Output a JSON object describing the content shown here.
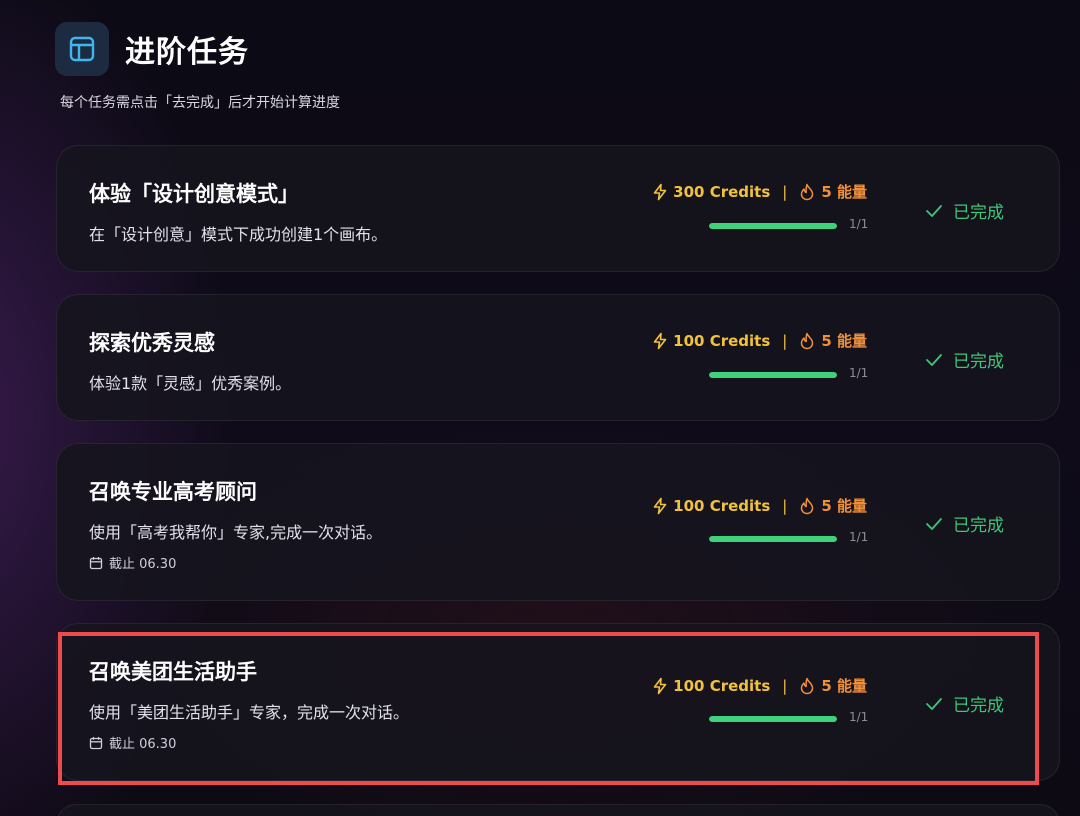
{
  "header": {
    "icon": "layout-icon",
    "title": "进阶任务",
    "subtitle": "每个任务需点击「去完成」后才开始计算进度"
  },
  "colors": {
    "credits": "#f3c23c",
    "energy": "#f0903a",
    "progress": "#3fd27d",
    "completed": "#3ec677",
    "highlight": "#ee4b4f"
  },
  "tasks": [
    {
      "title": "体验「设计创意模式」",
      "description": "在「设计创意」模式下成功创建1个画布。",
      "deadline": "",
      "credits": "300 Credits",
      "separator": "|",
      "energy": "5 能量",
      "progress": 1.0,
      "progress_text": "1/1",
      "status": "已完成"
    },
    {
      "title": "探索优秀灵感",
      "description": "体验1款「灵感」优秀案例。",
      "deadline": "",
      "credits": "100 Credits",
      "separator": "|",
      "energy": "5 能量",
      "progress": 1.0,
      "progress_text": "1/1",
      "status": "已完成"
    },
    {
      "title": "召唤专业高考顾问",
      "description": "使用「高考我帮你」专家,完成一次对话。",
      "deadline": "截止 06.30",
      "credits": "100 Credits",
      "separator": "|",
      "energy": "5 能量",
      "progress": 1.0,
      "progress_text": "1/1",
      "status": "已完成"
    },
    {
      "title": "召唤美团生活助手",
      "description": "使用「美团生活助手」专家，完成一次对话。",
      "deadline": "截止 06.30",
      "credits": "100 Credits",
      "separator": "|",
      "energy": "5 能量",
      "progress": 1.0,
      "progress_text": "1/1",
      "status": "已完成"
    }
  ]
}
